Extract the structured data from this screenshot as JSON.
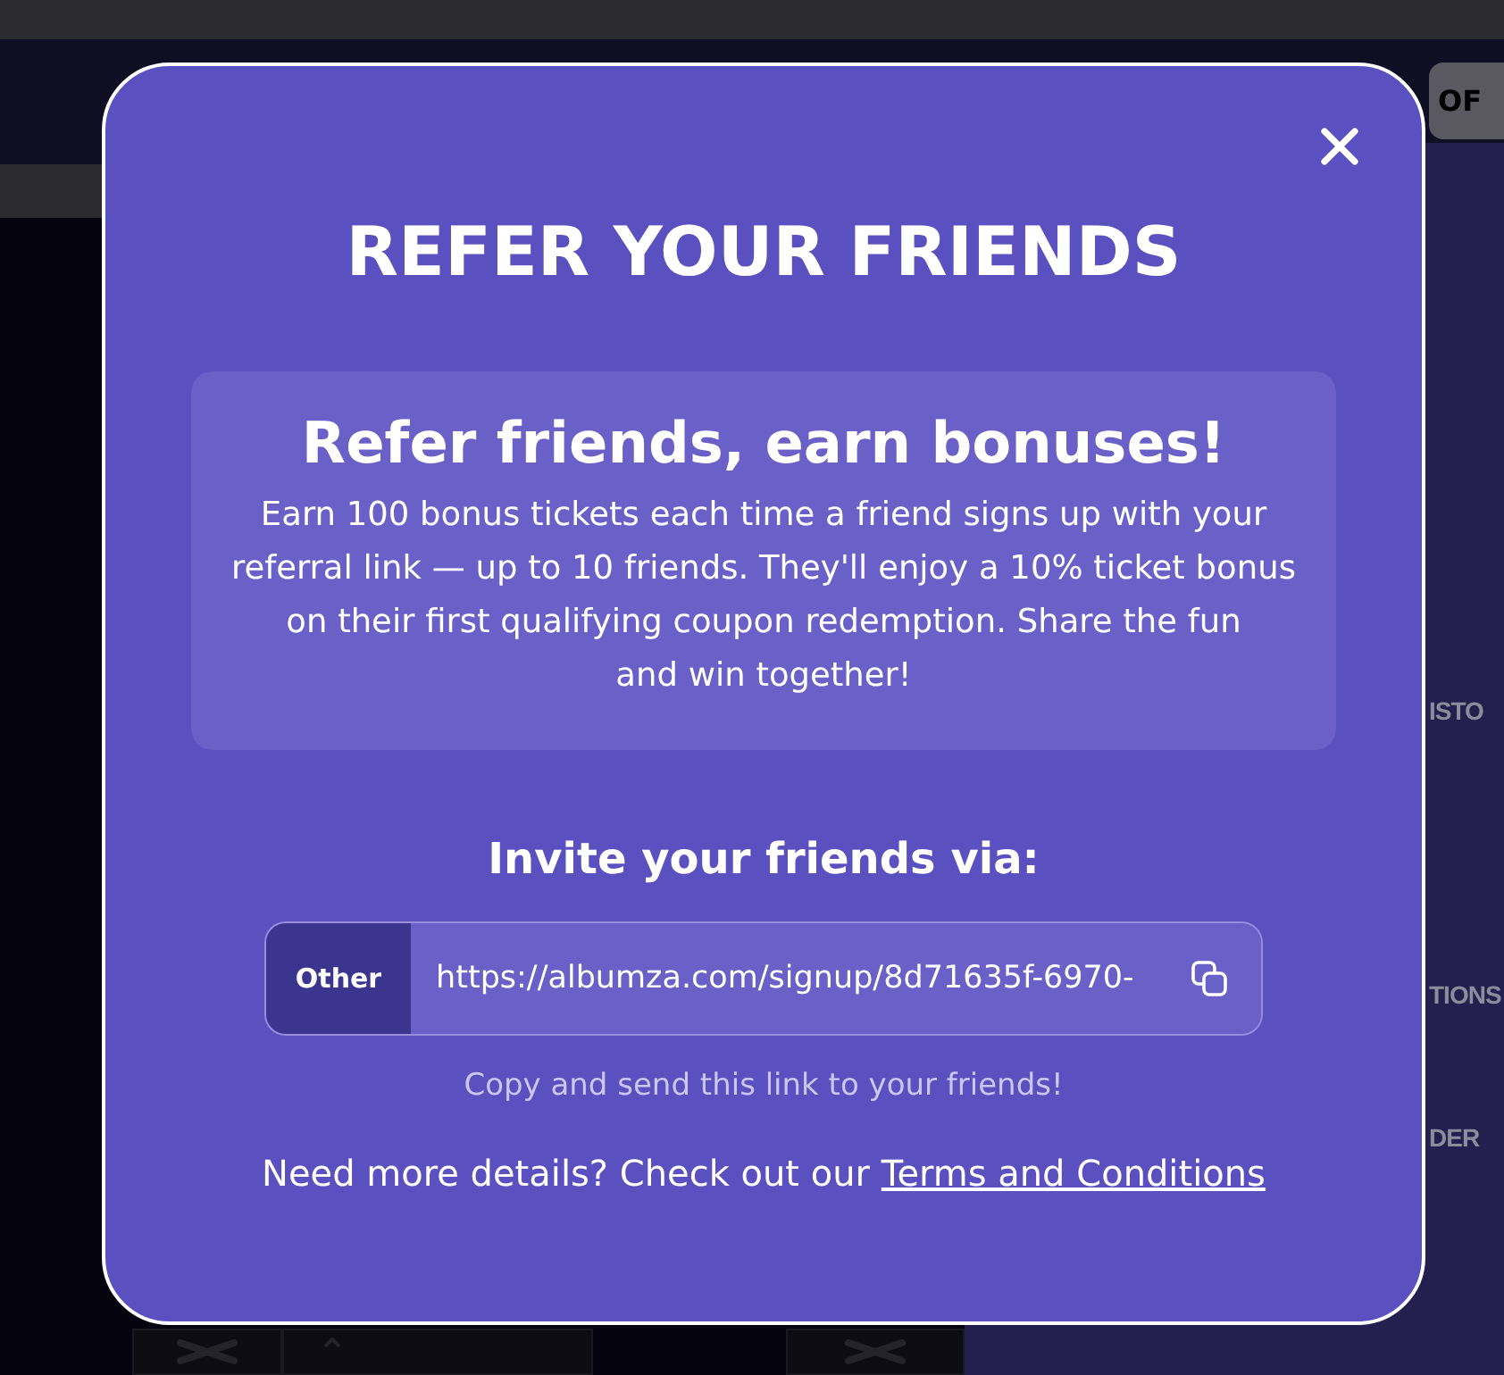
{
  "background": {
    "tab": "OF",
    "menu_items": [
      "ISTO",
      "TIONS",
      "DER"
    ]
  },
  "modal": {
    "title": "REFER YOUR FRIENDS",
    "info": {
      "heading": "Refer friends, earn bonuses!",
      "text_lines": [
        "Earn 100 bonus tickets each time a friend signs up with your",
        "referral link — up to 10 friends. They'll enjoy a 10% ticket bonus",
        "on their first qualifying coupon redemption. Share the fun",
        "and win together!"
      ]
    },
    "invite_heading": "Invite your friends via:",
    "share": {
      "channel": "Other",
      "link": "https://albumza.com/signup/8d71635f-6970-"
    },
    "hint": "Copy and send this link to your friends!",
    "footer": {
      "text": "Need more details? Check out our",
      "link": "Terms and Conditions"
    }
  }
}
